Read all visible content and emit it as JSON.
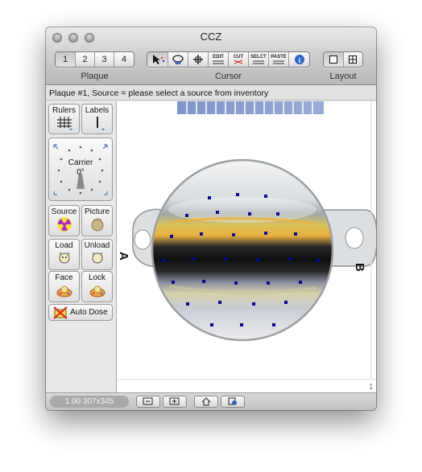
{
  "window": {
    "title": "CCZ"
  },
  "toolbar": {
    "plaque": {
      "label": "Plaque",
      "items": [
        "1",
        "2",
        "3",
        "4"
      ],
      "selected": "1"
    },
    "cursor": {
      "label": "Cursor",
      "items": [
        {
          "name": "select-cursor-icon",
          "text": ""
        },
        {
          "name": "hand-cursor-icon",
          "text": ""
        },
        {
          "name": "move-cursor-icon",
          "text": ""
        },
        {
          "name": "edit-icon",
          "text": "EDIT"
        },
        {
          "name": "cut-icon",
          "text": "CUT"
        },
        {
          "name": "select-icon",
          "text": "SELCT"
        },
        {
          "name": "paste-icon",
          "text": "PASTE"
        },
        {
          "name": "info-icon",
          "text": "i"
        }
      ]
    },
    "layout": {
      "label": "Layout"
    }
  },
  "status": {
    "text": "Plaque #1, Source = please select a source from inventory"
  },
  "tools": {
    "rulers": "Rulers",
    "labels": "Labels",
    "carrier": "Carrier",
    "carrier_angle": "0°",
    "source": "Source",
    "picture": "Picture",
    "load": "Load",
    "unload": "Unload",
    "face": "Face",
    "lock": "Lock",
    "auto_dose": "Auto Dose"
  },
  "canvas": {
    "label_left": "A",
    "label_right": "B",
    "page_number": "1"
  },
  "bottom": {
    "zoom_text": "1.00 307x345"
  },
  "colors": {
    "seed": "#0a0a8c",
    "strip": "#7f94c9"
  }
}
